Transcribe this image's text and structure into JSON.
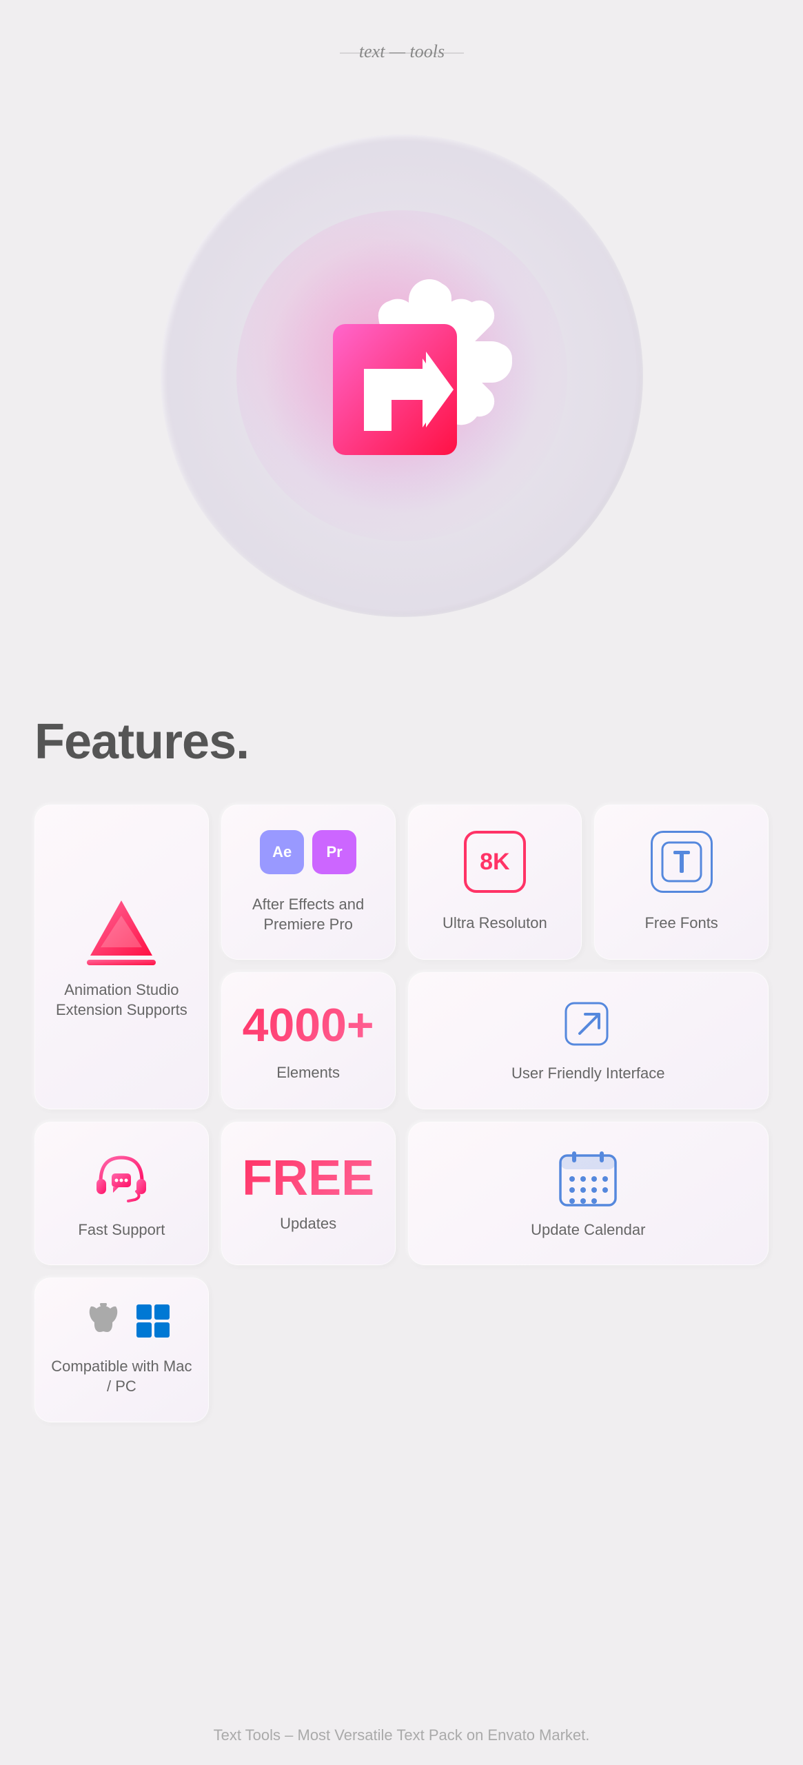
{
  "header": {
    "logo_text": "text tools"
  },
  "hero": {
    "aria_label": "Text Tools Logo - asterisk and arrow graphic"
  },
  "features": {
    "title": "Features.",
    "cards": {
      "animation_studio": {
        "label": "Animation Studio\nExtension Supports"
      },
      "ae_pr": {
        "badge_ae": "Ae",
        "badge_pr": "Pr",
        "label": "After Effects and Premiere Pro"
      },
      "ultra_res": {
        "badge": "8K",
        "label": "Ultra Resoluton"
      },
      "free_fonts": {
        "badge": "T",
        "label": "Free Fonts"
      },
      "elements": {
        "count": "4000+",
        "label": "Elements"
      },
      "user_friendly": {
        "label": "User Friendly Interface"
      },
      "fast_support": {
        "label": "Fast Support"
      },
      "free_updates": {
        "big_text": "FREE",
        "label": "Updates"
      },
      "update_calendar": {
        "label": "Update Calendar"
      },
      "mac_pc": {
        "label": "Compatible with Mac / PC"
      }
    }
  },
  "footer": {
    "text": "Text Tools – Most Versatile Text Pack on Envato Market."
  }
}
